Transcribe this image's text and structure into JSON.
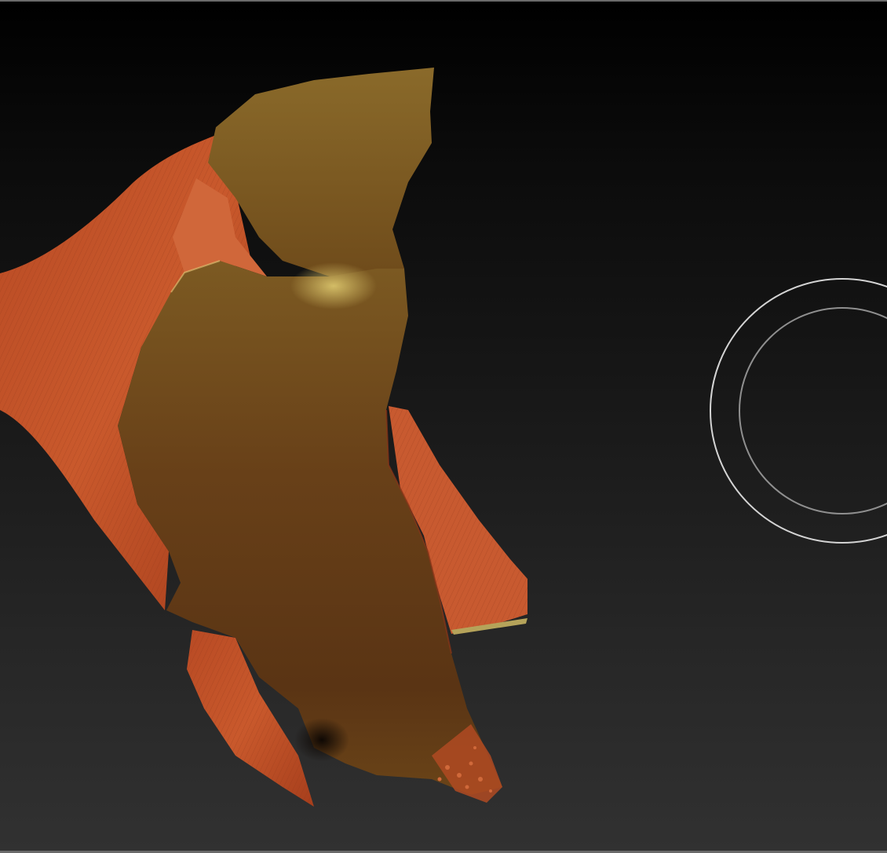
{
  "viewport": {
    "background_top": "#000000",
    "background_bottom": "#313131",
    "frame_color": "#6a6a6a"
  },
  "mesh": {
    "outer_skin_color": "#c8532a",
    "inner_surface_color": "#6e4418",
    "highlight_color": "#c9b15a"
  },
  "brush_cursor": {
    "outer_ring_color": "#d4d4d4",
    "inner_ring_color": "#8f8f8f"
  }
}
